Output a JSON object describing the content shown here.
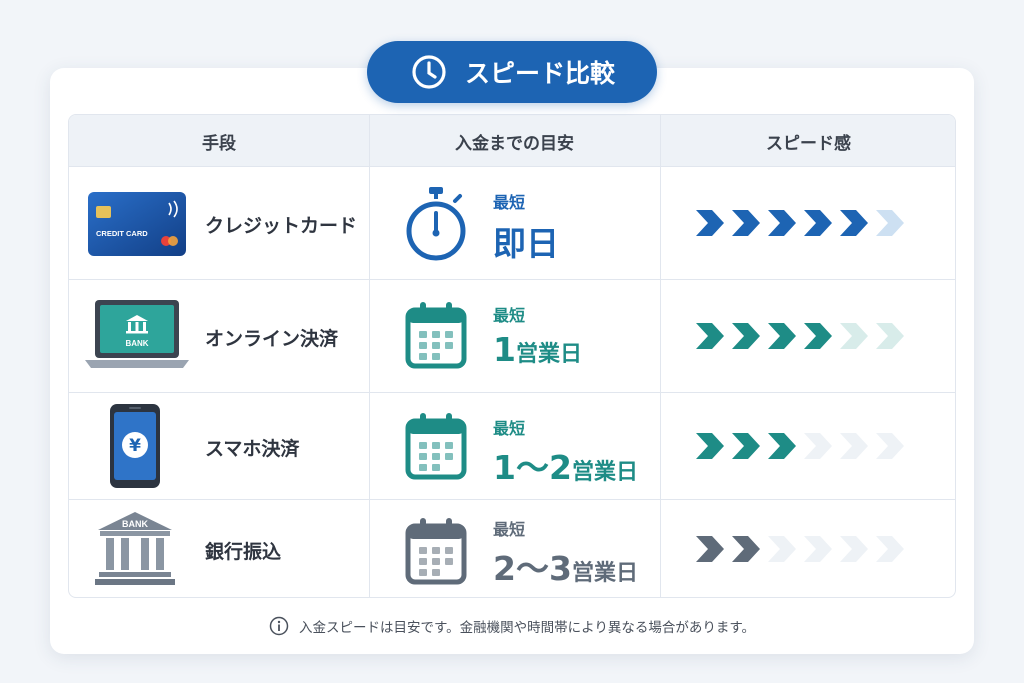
{
  "title": "スピード比較",
  "columns": [
    "手段",
    "入金までの目安",
    "スピード感"
  ],
  "rows": [
    {
      "method": "クレジットカード",
      "icon": "credit-card-icon",
      "card_text": "CREDIT CARD",
      "time_icon": "stopwatch-icon",
      "time_small": "最短",
      "time_num": "即日",
      "time_unit": "",
      "color": "#1d64b3",
      "speed": 5,
      "speed_color": "#1d64b3",
      "speed_light": "#cde0f2"
    },
    {
      "method": "オンライン決済",
      "icon": "laptop-bank-icon",
      "screen_text": "BANK",
      "time_icon": "calendar-icon",
      "time_small": "最短",
      "time_num": "1",
      "time_unit": "営業日",
      "color": "#1e8c86",
      "speed": 4,
      "speed_color": "#1e8c86",
      "speed_light": "#d8ecea"
    },
    {
      "method": "スマホ決済",
      "icon": "smartphone-yen-icon",
      "screen_text": "¥",
      "time_icon": "calendar-icon",
      "time_small": "最短",
      "time_num": "1〜2",
      "time_unit": "営業日",
      "color": "#1e8c86",
      "speed": 3,
      "speed_color": "#1e8c86",
      "speed_light": "#eef2f6"
    },
    {
      "method": "銀行振込",
      "icon": "bank-building-icon",
      "building_text": "BANK",
      "time_icon": "calendar-icon",
      "time_small": "最短",
      "time_num": "2〜3",
      "time_unit": "営業日",
      "color": "#5f6b79",
      "speed": 2,
      "speed_color": "#5f6b79",
      "speed_light": "#eef2f6"
    }
  ],
  "speed_max": 6,
  "footnote": "入金スピードは目安です。金融機関や時間帯により異なる場合があります。"
}
